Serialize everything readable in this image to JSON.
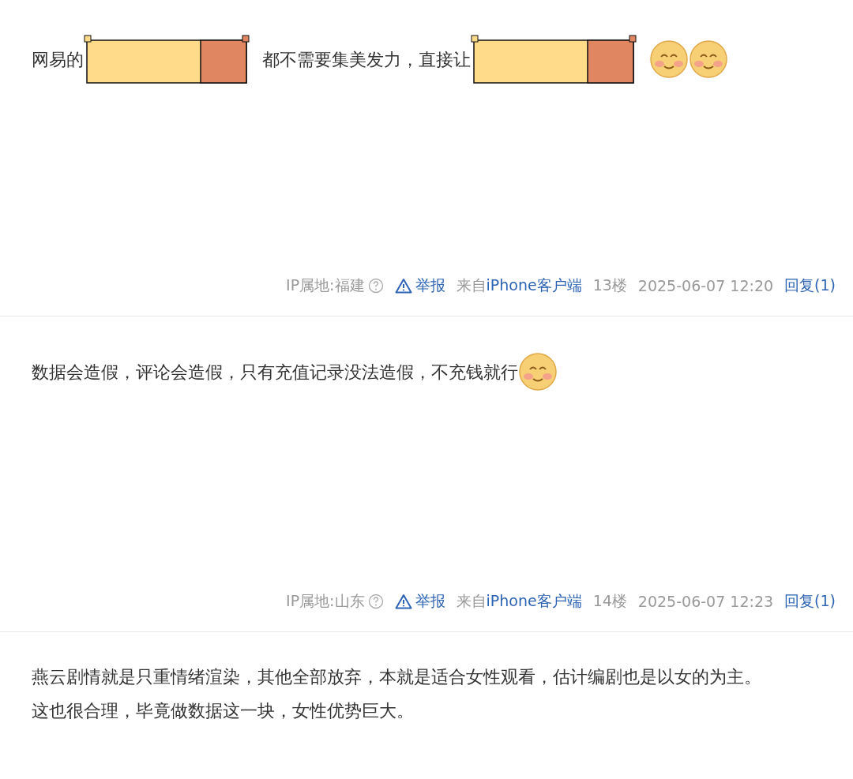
{
  "posts": [
    {
      "content": [
        {
          "kind": "text",
          "text": "网易的"
        },
        {
          "kind": "redaction"
        },
        {
          "kind": "text",
          "text": "都不需要集美发力，直接让"
        },
        {
          "kind": "redaction"
        },
        {
          "kind": "emoji"
        },
        {
          "kind": "emoji"
        }
      ],
      "meta": {
        "ip": "IP属地:福建",
        "report": "举报",
        "source_prefix": "来自",
        "source": "iPhone客户端",
        "floor": "13楼",
        "time": "2025-06-07 12:20",
        "reply": "回复(1)"
      }
    },
    {
      "content": [
        {
          "kind": "text",
          "text": "数据会造假，评论会造假，只有充值记录没法造假，不充钱就行"
        },
        {
          "kind": "emoji"
        }
      ],
      "meta": {
        "ip": "IP属地:山东",
        "report": "举报",
        "source_prefix": "来自",
        "source": "iPhone客户端",
        "floor": "14楼",
        "time": "2025-06-07 12:23",
        "reply": "回复(1)"
      }
    },
    {
      "content": [
        {
          "kind": "paragraph",
          "text": "燕云剧情就是只重情绪渲染，其他全部放弃，本就是适合女性观看，估计编剧也是以女的为主。"
        },
        {
          "kind": "paragraph",
          "text": "这也很合理，毕竟做数据这一块，女性优势巨大。"
        }
      ]
    }
  ]
}
